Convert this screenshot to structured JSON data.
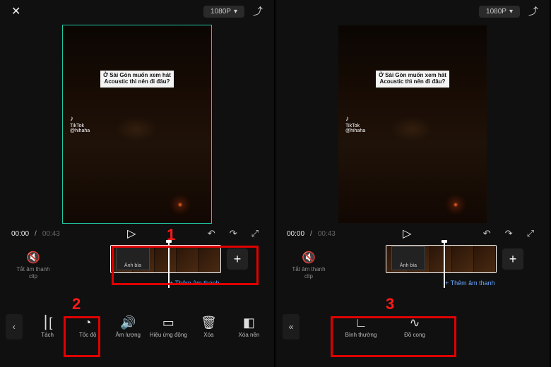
{
  "left": {
    "top": {
      "resolution": "1080P"
    },
    "preview": {
      "caption": "Ở Sài Gòn muốn xem hát Acoustic thì nên đi đâu?",
      "tiktok_brand": "TikTok",
      "tiktok_handle": "@hihaha"
    },
    "transport": {
      "current": "00:00",
      "duration": "00:43"
    },
    "timeline": {
      "mute_label": "Tắt âm thanh clip",
      "cover_label": "Ảnh bìa",
      "add_audio": "+ Thêm âm thanh"
    },
    "toolbar": {
      "items": [
        {
          "label": "Tách"
        },
        {
          "label": "Tốc độ"
        },
        {
          "label": "Âm lượng"
        },
        {
          "label": "Hiệu ứng động"
        },
        {
          "label": "Xóa"
        },
        {
          "label": "Xóa nền"
        }
      ]
    },
    "callouts": {
      "one": "1",
      "two": "2"
    }
  },
  "right": {
    "top": {
      "resolution": "1080P"
    },
    "preview": {
      "caption": "Ở Sài Gòn muốn xem hát Acoustic thì nên đi đâu?",
      "tiktok_brand": "TikTok",
      "tiktok_handle": "@hihaha"
    },
    "transport": {
      "current": "00:00",
      "duration": "00:43"
    },
    "timeline": {
      "mute_label": "Tắt âm thanh clip",
      "cover_label": "Ảnh bìa",
      "add_audio": "+ Thêm âm thanh"
    },
    "toolbar": {
      "items": [
        {
          "label": "Bình thường"
        },
        {
          "label": "Đồ cong"
        }
      ]
    },
    "callouts": {
      "three": "3"
    }
  }
}
